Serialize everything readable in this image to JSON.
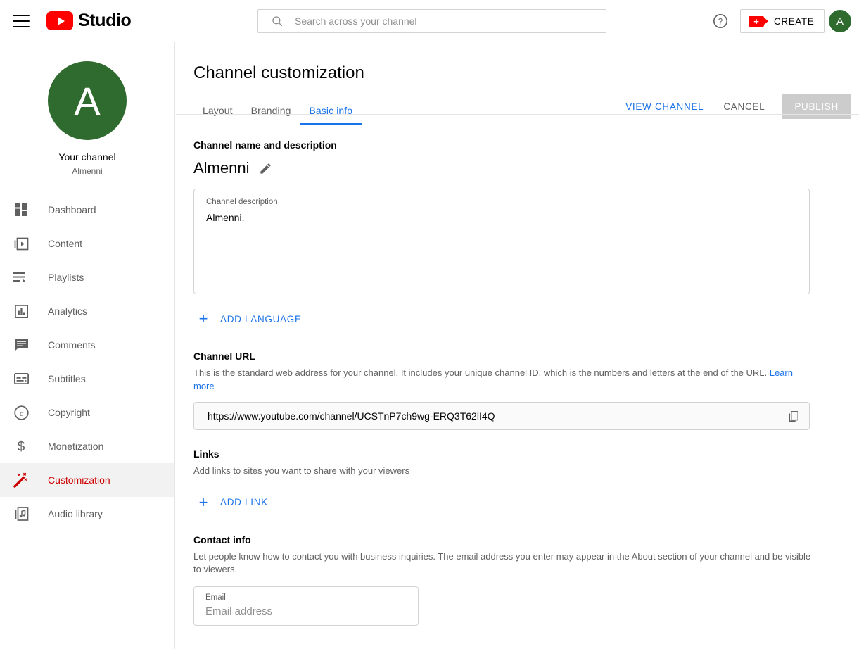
{
  "header": {
    "menu_icon": "hamburger-menu-icon",
    "logo_text": "Studio",
    "logo_icon": "youtube-play-icon",
    "search": {
      "placeholder": "Search across your channel",
      "value": "",
      "icon": "search-icon"
    },
    "help_icon": "help-circle-icon",
    "create_label": "CREATE",
    "create_icon": "video-camera-plus-icon",
    "avatar_initial": "A",
    "avatar_color": "#2f6b2f"
  },
  "sidebar": {
    "avatar_initial": "A",
    "channel_title": "Your channel",
    "channel_name": "Almenni",
    "items": [
      {
        "label": "Dashboard",
        "icon": "dashboard-icon",
        "active": false
      },
      {
        "label": "Content",
        "icon": "content-video-icon",
        "active": false
      },
      {
        "label": "Playlists",
        "icon": "playlist-icon",
        "active": false
      },
      {
        "label": "Analytics",
        "icon": "analytics-bar-icon",
        "active": false
      },
      {
        "label": "Comments",
        "icon": "comment-icon",
        "active": false
      },
      {
        "label": "Subtitles",
        "icon": "subtitles-icon",
        "active": false
      },
      {
        "label": "Copyright",
        "icon": "copyright-icon",
        "active": false
      },
      {
        "label": "Monetization",
        "icon": "dollar-icon",
        "active": false
      },
      {
        "label": "Customization",
        "icon": "magic-wand-icon",
        "active": true
      },
      {
        "label": "Audio library",
        "icon": "music-note-icon",
        "active": false
      }
    ],
    "active_color": "#cc0000"
  },
  "main": {
    "page_title": "Channel customization",
    "tabs": [
      {
        "label": "Layout",
        "active": false
      },
      {
        "label": "Branding",
        "active": false
      },
      {
        "label": "Basic info",
        "active": true
      }
    ],
    "accent_color": "#1a73e8",
    "actions": {
      "view_channel": "VIEW CHANNEL",
      "cancel": "CANCEL",
      "publish": "PUBLISH"
    },
    "name_section": {
      "heading": "Channel name and description",
      "channel_name": "Almenni",
      "edit_icon": "pencil-edit-icon",
      "description_label": "Channel description",
      "description_value": "Almenni.",
      "add_language_label": "ADD LANGUAGE",
      "add_language_icon": "plus-icon"
    },
    "url_section": {
      "heading": "Channel URL",
      "description_part1": "This is the standard web address for your channel. It includes your unique channel ID, which is the numbers and letters at the end of the URL. ",
      "learn_more": "Learn more",
      "url_value": "https://www.youtube.com/channel/UCSTnP7ch9wg-ERQ3T62lI4Q",
      "copy_icon": "copy-icon"
    },
    "links_section": {
      "heading": "Links",
      "description": "Add links to sites you want to share with your viewers",
      "add_link_label": "ADD LINK",
      "add_link_icon": "plus-icon"
    },
    "contact_section": {
      "heading": "Contact info",
      "description": "Let people know how to contact you with business inquiries. The email address you enter may appear in the About section of your channel and be visible to viewers.",
      "email_label": "Email",
      "email_placeholder": "Email address",
      "email_value": ""
    }
  }
}
